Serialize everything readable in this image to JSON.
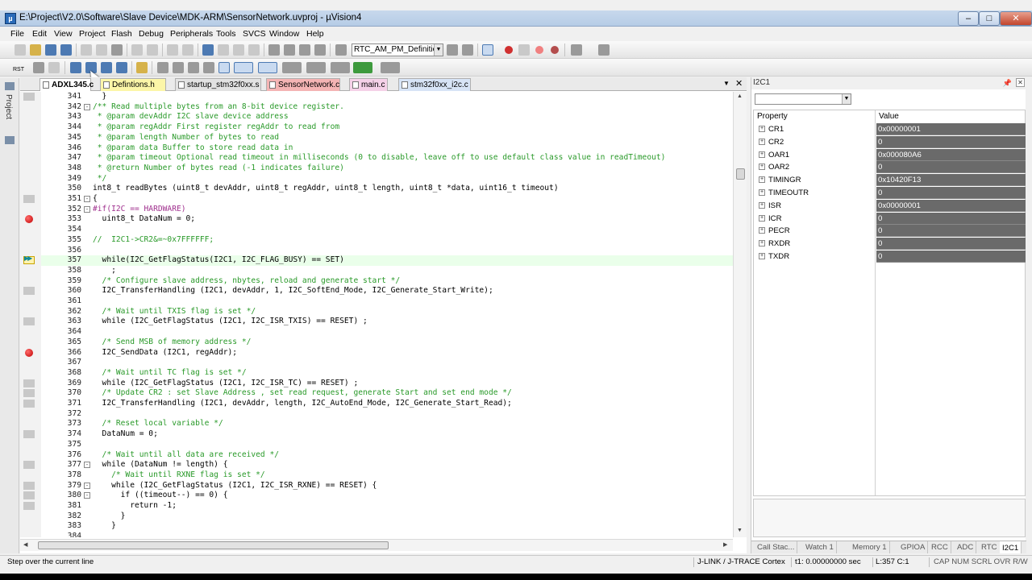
{
  "window": {
    "title": "E:\\Project\\V2.0\\Software\\Slave Device\\MDK-ARM\\SensorNetwork.uvproj - µVision4",
    "controls": [
      "–",
      "□",
      "✕"
    ]
  },
  "menu": [
    "File",
    "Edit",
    "View",
    "Project",
    "Flash",
    "Debug",
    "Peripherals",
    "Tools",
    "SVCS",
    "Window",
    "Help"
  ],
  "toolbar": {
    "target_select": "RTC_AM_PM_Definitions",
    "rst_label": "RST"
  },
  "left_strip": {
    "label": "Project"
  },
  "editor": {
    "tabs": [
      {
        "label": "ADXL345.c",
        "color": "#ffffff",
        "active": true
      },
      {
        "label": "Defintions.h",
        "color": "#fcf6a8"
      },
      {
        "label": "startup_stm32f0xx.s",
        "color": "#e2e2e2"
      },
      {
        "label": "SensorNetwork.c",
        "color": "#f4b4b4"
      },
      {
        "label": "main.c",
        "color": "#f5d1e8"
      },
      {
        "label": "stm32f0xx_i2c.c",
        "color": "#d7e4f6"
      }
    ],
    "tab_controls": [
      "▼",
      "✕"
    ],
    "current_line": 357,
    "lines": [
      {
        "n": "341",
        "t": "  }",
        "c": "plain"
      },
      {
        "n": "342",
        "t": "/** Read multiple bytes from an 8-bit device register.",
        "c": "cm",
        "fold": "-"
      },
      {
        "n": "343",
        "t": " * @param devAddr I2C slave device address",
        "c": "cm"
      },
      {
        "n": "344",
        "t": " * @param regAddr First register regAddr to read from",
        "c": "cm"
      },
      {
        "n": "345",
        "t": " * @param length Number of bytes to read",
        "c": "cm"
      },
      {
        "n": "346",
        "t": " * @param data Buffer to store read data in",
        "c": "cm"
      },
      {
        "n": "347",
        "t": " * @param timeout Optional read timeout in milliseconds (0 to disable, leave off to use default class value in readTimeout)",
        "c": "cm"
      },
      {
        "n": "348",
        "t": " * @return Number of bytes read (-1 indicates failure)",
        "c": "cm"
      },
      {
        "n": "349",
        "t": " */",
        "c": "cm"
      },
      {
        "n": "350",
        "t": "int8_t readBytes (uint8_t devAddr, uint8_t regAddr, uint8_t length, uint8_t *data, uint16_t timeout)",
        "c": "plain"
      },
      {
        "n": "351",
        "t": "{",
        "c": "plain",
        "fold": "-"
      },
      {
        "n": "352",
        "t": "#if(I2C == HARDWARE)",
        "c": "pp",
        "fold": "-"
      },
      {
        "n": "353",
        "t": "  uint8_t DataNum = 0;",
        "c": "plain"
      },
      {
        "n": "354",
        "t": "",
        "c": "plain"
      },
      {
        "n": "355",
        "t": "//  I2C1->CR2&=~0x7FFFFFF;",
        "c": "cm"
      },
      {
        "n": "356",
        "t": "",
        "c": "plain"
      },
      {
        "n": "357",
        "t": "  while(I2C_GetFlagStatus(I2C1, I2C_FLAG_BUSY) == SET)",
        "c": "kwline"
      },
      {
        "n": "358",
        "t": "    ;",
        "c": "plain"
      },
      {
        "n": "359",
        "t": "  /* Configure slave address, nbytes, reload and generate start */",
        "c": "cm"
      },
      {
        "n": "360",
        "t": "  I2C_TransferHandling (I2C1, devAddr, 1, I2C_SoftEnd_Mode, I2C_Generate_Start_Write);",
        "c": "plain"
      },
      {
        "n": "361",
        "t": "",
        "c": "plain"
      },
      {
        "n": "362",
        "t": "  /* Wait until TXIS flag is set */",
        "c": "cm"
      },
      {
        "n": "363",
        "t": "  while (I2C_GetFlagStatus (I2C1, I2C_ISR_TXIS) == RESET) ;",
        "c": "kwline"
      },
      {
        "n": "364",
        "t": "",
        "c": "plain"
      },
      {
        "n": "365",
        "t": "  /* Send MSB of memory address */",
        "c": "cm"
      },
      {
        "n": "366",
        "t": "  I2C_SendData (I2C1, regAddr);",
        "c": "plain"
      },
      {
        "n": "367",
        "t": "",
        "c": "plain"
      },
      {
        "n": "368",
        "t": "  /* Wait until TC flag is set */",
        "c": "cm"
      },
      {
        "n": "369",
        "t": "  while (I2C_GetFlagStatus (I2C1, I2C_ISR_TC) == RESET) ;",
        "c": "kwline"
      },
      {
        "n": "370",
        "t": "  /* Update CR2 : set Slave Address , set read request, generate Start and set end mode */",
        "c": "cm"
      },
      {
        "n": "371",
        "t": "  I2C_TransferHandling (I2C1, devAddr, length, I2C_AutoEnd_Mode, I2C_Generate_Start_Read);",
        "c": "plain"
      },
      {
        "n": "372",
        "t": "",
        "c": "plain"
      },
      {
        "n": "373",
        "t": "  /* Reset local variable */",
        "c": "cm"
      },
      {
        "n": "374",
        "t": "  DataNum = 0;",
        "c": "plain"
      },
      {
        "n": "375",
        "t": "",
        "c": "plain"
      },
      {
        "n": "376",
        "t": "  /* Wait until all data are received */",
        "c": "cm"
      },
      {
        "n": "377",
        "t": "  while (DataNum != length) {",
        "c": "kwline",
        "fold": "-"
      },
      {
        "n": "378",
        "t": "    /* Wait until RXNE flag is set */",
        "c": "cm"
      },
      {
        "n": "379",
        "t": "    while (I2C_GetFlagStatus (I2C1, I2C_ISR_RXNE) == RESET) {",
        "c": "kwline",
        "fold": "-"
      },
      {
        "n": "380",
        "t": "      if ((timeout--) == 0) {",
        "c": "kwline",
        "fold": "-"
      },
      {
        "n": "381",
        "t": "        return -1;",
        "c": "kwline"
      },
      {
        "n": "382",
        "t": "      }",
        "c": "plain"
      },
      {
        "n": "383",
        "t": "    }",
        "c": "plain"
      },
      {
        "n": "384",
        "t": "",
        "c": "plain"
      }
    ],
    "gutter_marks": [
      341,
      351,
      353,
      357,
      360,
      363,
      366,
      369,
      370,
      371,
      374,
      377,
      379,
      380,
      381
    ],
    "breakpoints": [
      353,
      366
    ]
  },
  "registers_panel": {
    "title": "I2C1",
    "pin_icon": "pin-icon",
    "col_property": "Property",
    "col_value": "Value",
    "rows": [
      {
        "name": "CR1",
        "value": "0x00000001"
      },
      {
        "name": "CR2",
        "value": "0"
      },
      {
        "name": "OAR1",
        "value": "0x000080A6"
      },
      {
        "name": "OAR2",
        "value": "0"
      },
      {
        "name": "TIMINGR",
        "value": "0x10420F13"
      },
      {
        "name": "TIMEOUTR",
        "value": "0"
      },
      {
        "name": "ISR",
        "value": "0x00000001"
      },
      {
        "name": "ICR",
        "value": "0"
      },
      {
        "name": "PECR",
        "value": "0"
      },
      {
        "name": "RXDR",
        "value": "0"
      },
      {
        "name": "TXDR",
        "value": "0"
      }
    ],
    "tabs": [
      "Call Stac...",
      "Watch 1",
      "Memory 1",
      "GPIOA",
      "RCC",
      "ADC",
      "RTC",
      "I2C1"
    ],
    "active_tab": "I2C1"
  },
  "statusbar": {
    "message": "Step over the current line",
    "debugger": "J-LINK / J-TRACE Cortex",
    "time": "t1: 0.00000000 sec",
    "position": "L:357 C:1",
    "indicators": "CAP  NUM  SCRL  OVR  R/W"
  }
}
